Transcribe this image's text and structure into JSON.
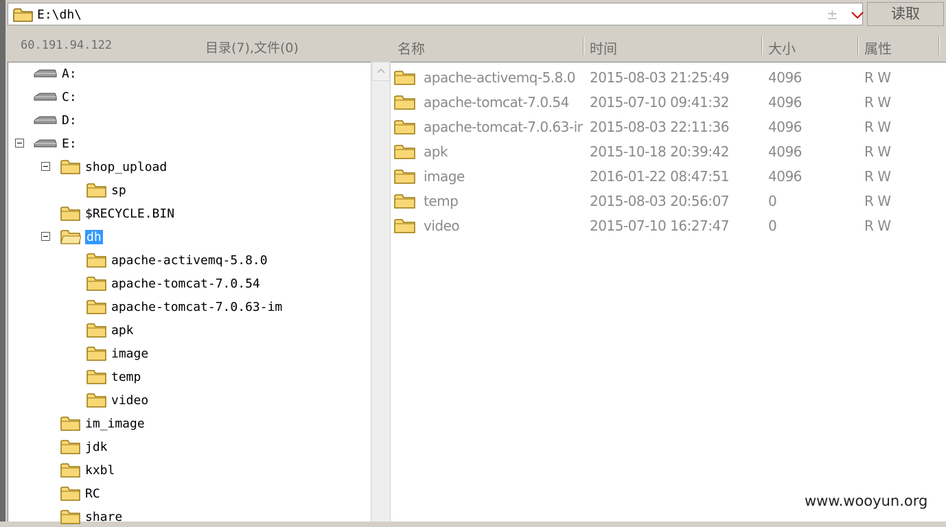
{
  "address_bar": {
    "path": "E:\\dh\\",
    "plusminus_glyph": "±"
  },
  "read_button": {
    "label": "读取"
  },
  "left_header": {
    "ip": "60.191.94.122",
    "summary": "目录(7),文件(0)"
  },
  "columns": {
    "name": "名称",
    "time": "时间",
    "size": "大小",
    "attr": "属性"
  },
  "tree": {
    "drives": [
      "A:",
      "C:",
      "D:",
      "E:"
    ],
    "shop_upload": "shop_upload",
    "sp": "sp",
    "recycle": "$RECYCLE.BIN",
    "dh": "dh",
    "dh_children": [
      "apache-activemq-5.8.0",
      "apache-tomcat-7.0.54",
      "apache-tomcat-7.0.63-im",
      "apk",
      "image",
      "temp",
      "video"
    ],
    "others": [
      "im_image",
      "jdk",
      "kxbl",
      "RC",
      "share"
    ]
  },
  "files": [
    {
      "name": "apache-activemq-5.8.0",
      "time": "2015-08-03 21:25:49",
      "size": "4096",
      "attr": "R W"
    },
    {
      "name": "apache-tomcat-7.0.54",
      "time": "2015-07-10 09:41:32",
      "size": "4096",
      "attr": "R W"
    },
    {
      "name": "apache-tomcat-7.0.63-im",
      "time": "2015-08-03 22:11:36",
      "size": "4096",
      "attr": "R W"
    },
    {
      "name": "apk",
      "time": "2015-10-18 20:39:42",
      "size": "4096",
      "attr": "R W"
    },
    {
      "name": "image",
      "time": "2016-01-22 08:47:51",
      "size": "4096",
      "attr": "R W"
    },
    {
      "name": "temp",
      "time": "2015-08-03 20:56:07",
      "size": "0",
      "attr": "R W"
    },
    {
      "name": "video",
      "time": "2015-07-10 16:27:47",
      "size": "0",
      "attr": "R W"
    }
  ],
  "watermark": "www.wooyun.org",
  "icons": {
    "folder": "folder-icon",
    "drive": "drive-icon",
    "expander": "collapse-icon",
    "dropdown": "chevron-down-icon",
    "scroll": "scroll-up-icon"
  },
  "colors": {
    "selection": "#3399ff",
    "folder_fill": "#f8d775",
    "folder_stroke": "#c29a22",
    "chevron": "#cc0000"
  }
}
